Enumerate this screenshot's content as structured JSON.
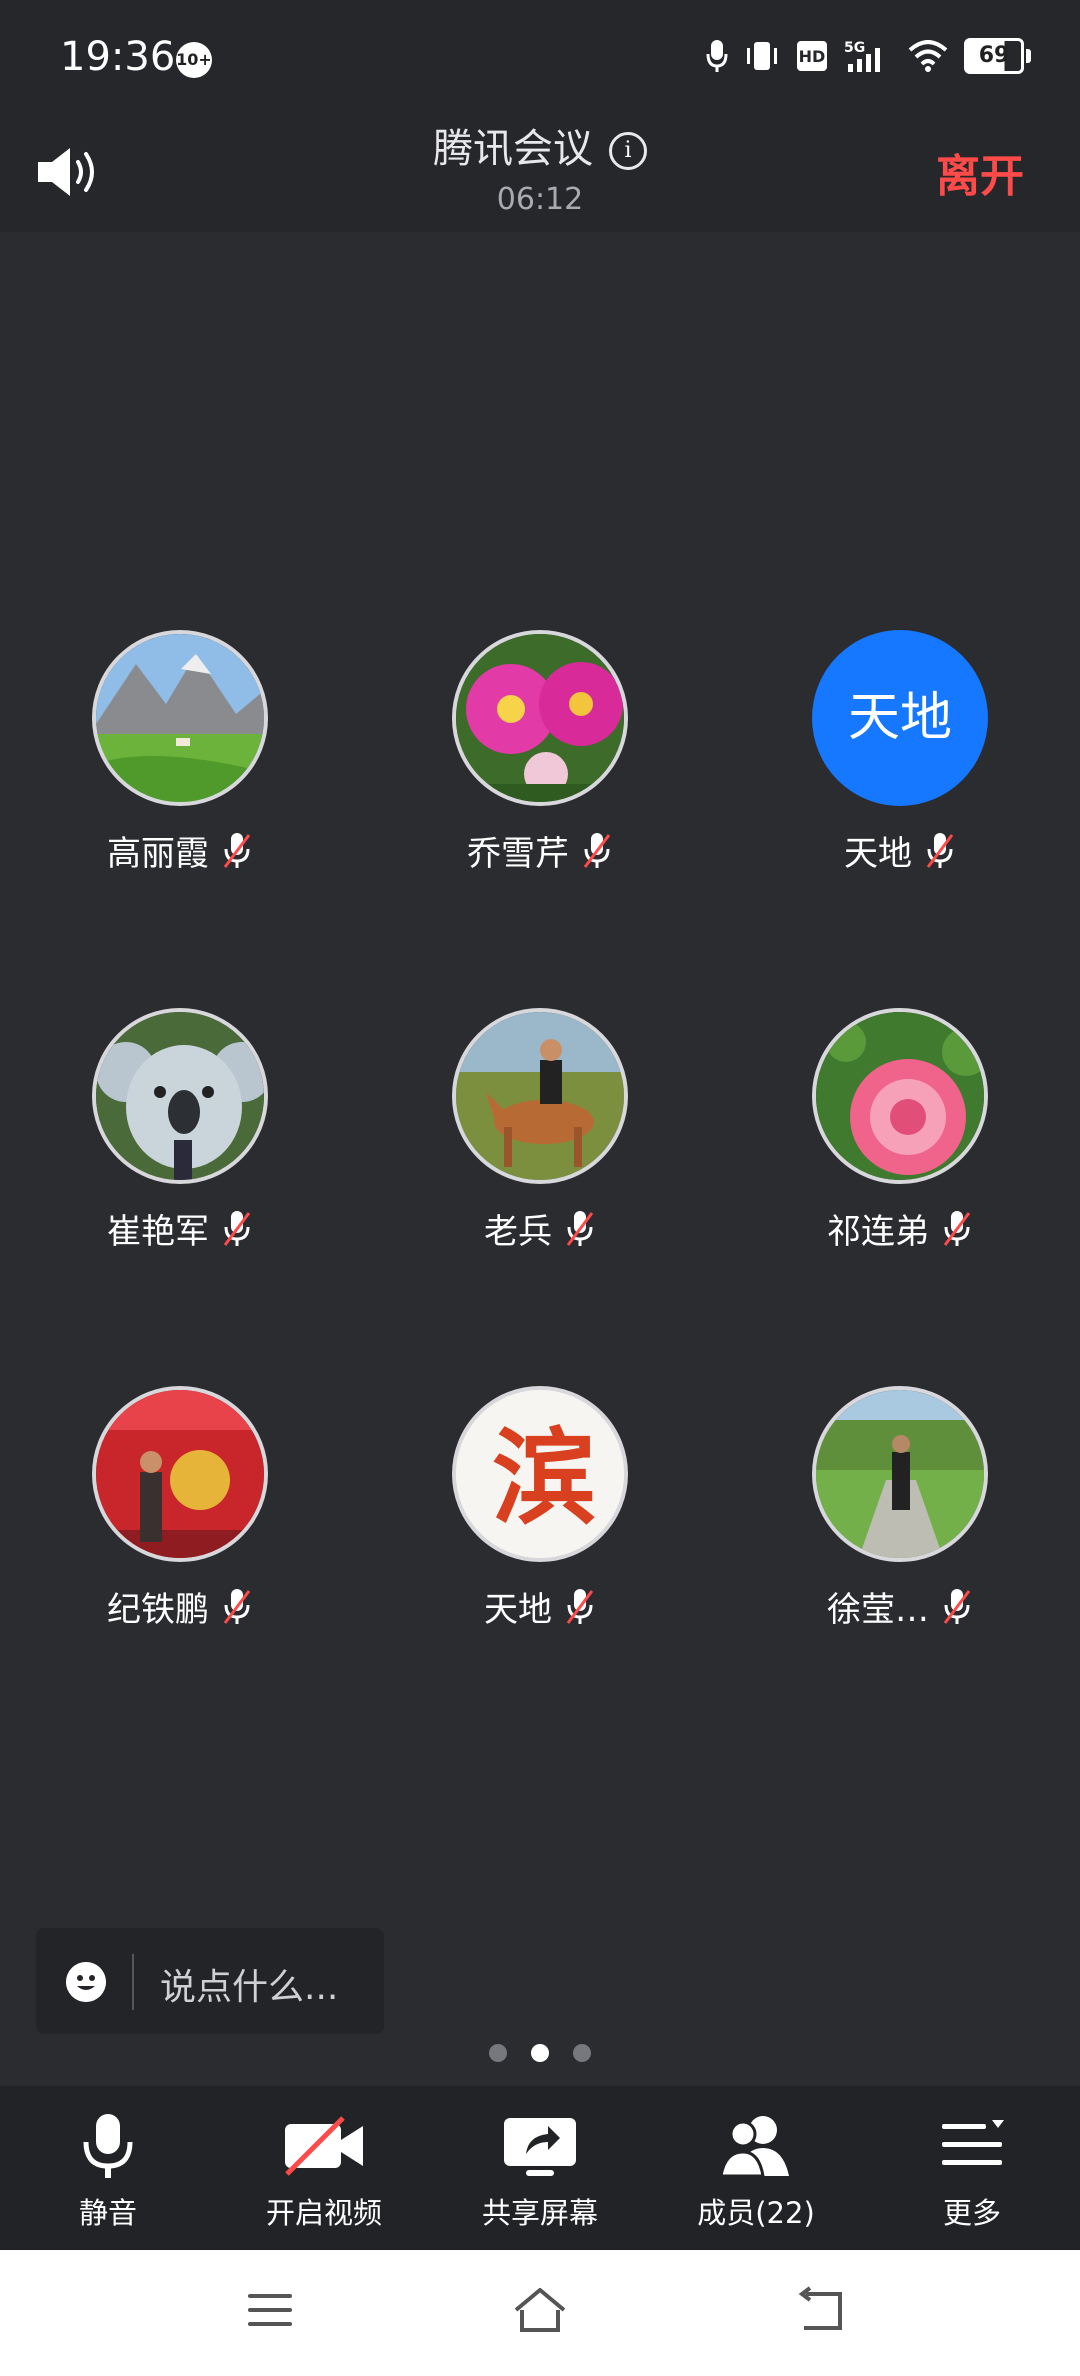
{
  "status_bar": {
    "time": "19:36",
    "badge": "10+",
    "battery": "69"
  },
  "header": {
    "title": "腾讯会议",
    "timer": "06:12",
    "leave_label": "离开"
  },
  "participants": [
    {
      "name": "高丽霞",
      "avatar": "photo-mountain-meadow"
    },
    {
      "name": "乔雪芹",
      "avatar": "photo-pink-dahlias"
    },
    {
      "name": "天地",
      "avatar_text": "天地",
      "avatar_color": "#1677ff"
    },
    {
      "name": "崔艳军",
      "avatar": "photo-koala-statue"
    },
    {
      "name": "老兵",
      "avatar": "photo-horse-rider"
    },
    {
      "name": "祁连弟",
      "avatar": "photo-pink-peony"
    },
    {
      "name": "纪铁鹏",
      "avatar": "photo-red-festival"
    },
    {
      "name": "天地",
      "avatar": "calligraphy-bin",
      "avatar_glyph": "滨"
    },
    {
      "name": "徐莹…",
      "avatar": "photo-park-lawn"
    }
  ],
  "chat": {
    "placeholder": "说点什么..."
  },
  "pager": {
    "pages": 3,
    "active": 1
  },
  "toolbar": {
    "mute": "静音",
    "video": "开启视频",
    "share": "共享屏幕",
    "members": "成员(22)",
    "more": "更多"
  },
  "colors": {
    "leave": "#ff4a4a",
    "accent": "#1677ff",
    "mic_off_slash": "#ff4a4a"
  }
}
